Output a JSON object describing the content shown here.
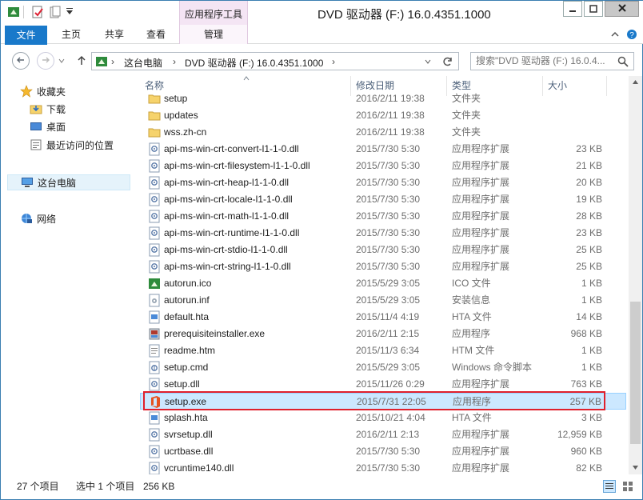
{
  "window": {
    "title": "DVD 驱动器 (F:) 16.0.4351.1000",
    "context_tab_group": "应用程序工具"
  },
  "ribbon": {
    "tabs": [
      "文件",
      "主页",
      "共享",
      "查看",
      "管理"
    ]
  },
  "nav": {
    "breadcrumb": [
      "这台电脑",
      "DVD 驱动器 (F:) 16.0.4351.1000"
    ],
    "search_placeholder": "搜索\"DVD 驱动器 (F:) 16.0.4..."
  },
  "sidebar": {
    "favorites": "收藏夹",
    "fav_items": [
      "下载",
      "桌面",
      "最近访问的位置"
    ],
    "this_pc": "这台电脑",
    "network": "网络"
  },
  "columns": {
    "name": "名称",
    "date": "修改日期",
    "type": "类型",
    "size": "大小"
  },
  "files": [
    {
      "name": "setup",
      "date": "2016/2/11 19:38",
      "type": "文件夹",
      "size": "",
      "icon": "folder-icon"
    },
    {
      "name": "updates",
      "date": "2016/2/11 19:38",
      "type": "文件夹",
      "size": "",
      "icon": "folder-icon"
    },
    {
      "name": "wss.zh-cn",
      "date": "2016/2/11 19:38",
      "type": "文件夹",
      "size": "",
      "icon": "folder-icon"
    },
    {
      "name": "api-ms-win-crt-convert-l1-1-0.dll",
      "date": "2015/7/30 5:30",
      "type": "应用程序扩展",
      "size": "23 KB",
      "icon": "dll-icon"
    },
    {
      "name": "api-ms-win-crt-filesystem-l1-1-0.dll",
      "date": "2015/7/30 5:30",
      "type": "应用程序扩展",
      "size": "21 KB",
      "icon": "dll-icon"
    },
    {
      "name": "api-ms-win-crt-heap-l1-1-0.dll",
      "date": "2015/7/30 5:30",
      "type": "应用程序扩展",
      "size": "20 KB",
      "icon": "dll-icon"
    },
    {
      "name": "api-ms-win-crt-locale-l1-1-0.dll",
      "date": "2015/7/30 5:30",
      "type": "应用程序扩展",
      "size": "19 KB",
      "icon": "dll-icon"
    },
    {
      "name": "api-ms-win-crt-math-l1-1-0.dll",
      "date": "2015/7/30 5:30",
      "type": "应用程序扩展",
      "size": "28 KB",
      "icon": "dll-icon"
    },
    {
      "name": "api-ms-win-crt-runtime-l1-1-0.dll",
      "date": "2015/7/30 5:30",
      "type": "应用程序扩展",
      "size": "23 KB",
      "icon": "dll-icon"
    },
    {
      "name": "api-ms-win-crt-stdio-l1-1-0.dll",
      "date": "2015/7/30 5:30",
      "type": "应用程序扩展",
      "size": "25 KB",
      "icon": "dll-icon"
    },
    {
      "name": "api-ms-win-crt-string-l1-1-0.dll",
      "date": "2015/7/30 5:30",
      "type": "应用程序扩展",
      "size": "25 KB",
      "icon": "dll-icon"
    },
    {
      "name": "autorun.ico",
      "date": "2015/5/29 3:05",
      "type": "ICO 文件",
      "size": "1 KB",
      "icon": "image-icon"
    },
    {
      "name": "autorun.inf",
      "date": "2015/5/29 3:05",
      "type": "安装信息",
      "size": "1 KB",
      "icon": "settings-file-icon"
    },
    {
      "name": "default.hta",
      "date": "2015/11/4 4:19",
      "type": "HTA 文件",
      "size": "14 KB",
      "icon": "hta-icon"
    },
    {
      "name": "prerequisiteinstaller.exe",
      "date": "2016/2/11 2:15",
      "type": "应用程序",
      "size": "968 KB",
      "icon": "installer-icon"
    },
    {
      "name": "readme.htm",
      "date": "2015/11/3 6:34",
      "type": "HTM 文件",
      "size": "1 KB",
      "icon": "document-icon"
    },
    {
      "name": "setup.cmd",
      "date": "2015/5/29 3:05",
      "type": "Windows 命令脚本",
      "size": "1 KB",
      "icon": "script-icon"
    },
    {
      "name": "setup.dll",
      "date": "2015/11/26 0:29",
      "type": "应用程序扩展",
      "size": "763 KB",
      "icon": "dll-icon"
    },
    {
      "name": "setup.exe",
      "date": "2015/7/31 22:05",
      "type": "应用程序",
      "size": "257 KB",
      "icon": "office-icon",
      "selected": true
    },
    {
      "name": "splash.hta",
      "date": "2015/10/21 4:04",
      "type": "HTA 文件",
      "size": "3 KB",
      "icon": "hta-icon"
    },
    {
      "name": "svrsetup.dll",
      "date": "2016/2/11 2:13",
      "type": "应用程序扩展",
      "size": "12,959 KB",
      "icon": "dll-icon"
    },
    {
      "name": "ucrtbase.dll",
      "date": "2015/7/30 5:30",
      "type": "应用程序扩展",
      "size": "960 KB",
      "icon": "dll-icon"
    },
    {
      "name": "vcruntime140.dll",
      "date": "2015/7/30 5:30",
      "type": "应用程序扩展",
      "size": "82 KB",
      "icon": "dll-icon"
    }
  ],
  "status": {
    "count": "27 个项目",
    "selection": "选中 1 个项目",
    "selection_size": "256 KB"
  }
}
